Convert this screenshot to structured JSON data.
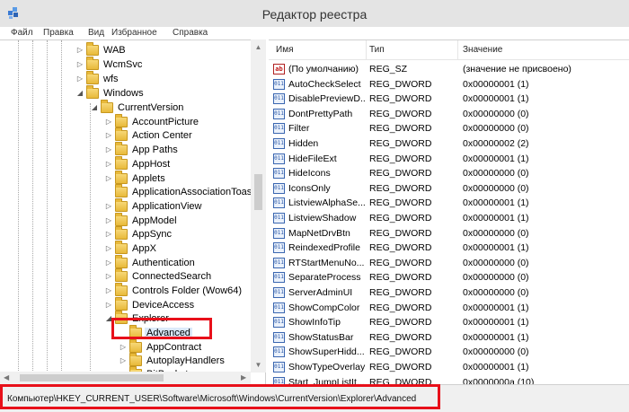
{
  "window": {
    "title": "Редактор реестра"
  },
  "menu": [
    "Файл",
    "Правка",
    "Вид",
    "Избранное",
    "Справка"
  ],
  "tree": [
    {
      "label": "WAB",
      "arrow": "▷"
    },
    {
      "label": "WcmSvc",
      "arrow": "▷"
    },
    {
      "label": "wfs",
      "arrow": "▷"
    },
    {
      "label": "Windows",
      "arrow": "◢"
    },
    {
      "label": "CurrentVersion",
      "arrow": "◢"
    },
    {
      "label": "AccountPicture",
      "arrow": "▷"
    },
    {
      "label": "Action Center",
      "arrow": "▷"
    },
    {
      "label": "App Paths",
      "arrow": "▷"
    },
    {
      "label": "AppHost",
      "arrow": "▷"
    },
    {
      "label": "Applets",
      "arrow": "▷"
    },
    {
      "label": "ApplicationAssociationToasts",
      "arrow": ""
    },
    {
      "label": "ApplicationView",
      "arrow": "▷"
    },
    {
      "label": "AppModel",
      "arrow": "▷"
    },
    {
      "label": "AppSync",
      "arrow": "▷"
    },
    {
      "label": "AppX",
      "arrow": "▷"
    },
    {
      "label": "Authentication",
      "arrow": "▷"
    },
    {
      "label": "ConnectedSearch",
      "arrow": "▷"
    },
    {
      "label": "Controls Folder (Wow64)",
      "arrow": "▷"
    },
    {
      "label": "DeviceAccess",
      "arrow": "▷"
    },
    {
      "label": "Explorer",
      "arrow": "◢"
    },
    {
      "label": "Advanced",
      "arrow": ""
    },
    {
      "label": "AppContract",
      "arrow": "▷"
    },
    {
      "label": "AutoplayHandlers",
      "arrow": "▷"
    },
    {
      "label": "BitBucket",
      "arrow": "▷"
    }
  ],
  "columns": {
    "name": "Имя",
    "type": "Тип",
    "value": "Значение"
  },
  "values": [
    {
      "name": "(По умолчанию)",
      "type": "REG_SZ",
      "value": "(значение не присвоено)",
      "icon": "ab"
    },
    {
      "name": "AutoCheckSelect",
      "type": "REG_DWORD",
      "value": "0x00000001 (1)",
      "icon": "dword"
    },
    {
      "name": "DisablePreviewD...",
      "type": "REG_DWORD",
      "value": "0x00000001 (1)",
      "icon": "dword"
    },
    {
      "name": "DontPrettyPath",
      "type": "REG_DWORD",
      "value": "0x00000000 (0)",
      "icon": "dword"
    },
    {
      "name": "Filter",
      "type": "REG_DWORD",
      "value": "0x00000000 (0)",
      "icon": "dword"
    },
    {
      "name": "Hidden",
      "type": "REG_DWORD",
      "value": "0x00000002 (2)",
      "icon": "dword"
    },
    {
      "name": "HideFileExt",
      "type": "REG_DWORD",
      "value": "0x00000001 (1)",
      "icon": "dword"
    },
    {
      "name": "HideIcons",
      "type": "REG_DWORD",
      "value": "0x00000000 (0)",
      "icon": "dword"
    },
    {
      "name": "IconsOnly",
      "type": "REG_DWORD",
      "value": "0x00000000 (0)",
      "icon": "dword"
    },
    {
      "name": "ListviewAlphaSe...",
      "type": "REG_DWORD",
      "value": "0x00000001 (1)",
      "icon": "dword"
    },
    {
      "name": "ListviewShadow",
      "type": "REG_DWORD",
      "value": "0x00000001 (1)",
      "icon": "dword"
    },
    {
      "name": "MapNetDrvBtn",
      "type": "REG_DWORD",
      "value": "0x00000000 (0)",
      "icon": "dword"
    },
    {
      "name": "ReindexedProfile",
      "type": "REG_DWORD",
      "value": "0x00000001 (1)",
      "icon": "dword"
    },
    {
      "name": "RTStartMenuNo...",
      "type": "REG_DWORD",
      "value": "0x00000000 (0)",
      "icon": "dword"
    },
    {
      "name": "SeparateProcess",
      "type": "REG_DWORD",
      "value": "0x00000000 (0)",
      "icon": "dword"
    },
    {
      "name": "ServerAdminUI",
      "type": "REG_DWORD",
      "value": "0x00000000 (0)",
      "icon": "dword"
    },
    {
      "name": "ShowCompColor",
      "type": "REG_DWORD",
      "value": "0x00000001 (1)",
      "icon": "dword"
    },
    {
      "name": "ShowInfoTip",
      "type": "REG_DWORD",
      "value": "0x00000001 (1)",
      "icon": "dword"
    },
    {
      "name": "ShowStatusBar",
      "type": "REG_DWORD",
      "value": "0x00000001 (1)",
      "icon": "dword"
    },
    {
      "name": "ShowSuperHidd...",
      "type": "REG_DWORD",
      "value": "0x00000000 (0)",
      "icon": "dword"
    },
    {
      "name": "ShowTypeOverlay",
      "type": "REG_DWORD",
      "value": "0x00000001 (1)",
      "icon": "dword"
    },
    {
      "name": "Start_JumpListIt...",
      "type": "REG_DWORD",
      "value": "0x0000000a (10)",
      "icon": "dword"
    }
  ],
  "status": {
    "path": "Компьютер\\HKEY_CURRENT_USER\\Software\\Microsoft\\Windows\\CurrentVersion\\Explorer\\Advanced"
  },
  "colors": {
    "highlight": "#e8101a",
    "selection": "#dbe9f9",
    "folder": "#e8b93a"
  }
}
